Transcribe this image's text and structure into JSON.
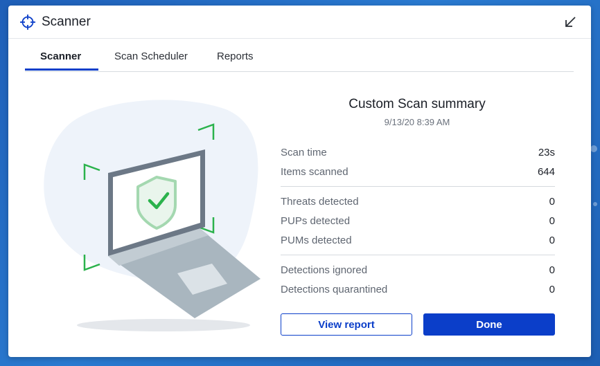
{
  "window": {
    "title": "Scanner"
  },
  "icons": {
    "app": "crosshair-icon",
    "minimize": "arrow-down-left-icon",
    "illustration": "laptop-shield-check-illustration"
  },
  "tabs": [
    {
      "label": "Scanner",
      "active": true
    },
    {
      "label": "Scan Scheduler",
      "active": false
    },
    {
      "label": "Reports",
      "active": false
    }
  ],
  "summary": {
    "title": "Custom Scan summary",
    "date": "9/13/20 8:39 AM",
    "rows": [
      {
        "label": "Scan time",
        "value": "23s"
      },
      {
        "label": "Items scanned",
        "value": "644"
      },
      {
        "label": "Threats detected",
        "value": "0"
      },
      {
        "label": "PUPs detected",
        "value": "0"
      },
      {
        "label": "PUMs detected",
        "value": "0"
      },
      {
        "label": "Detections ignored",
        "value": "0"
      },
      {
        "label": "Detections quarantined",
        "value": "0"
      }
    ]
  },
  "buttons": {
    "view_report": "View report",
    "done": "Done"
  },
  "colors": {
    "accent": "#0b3ec9",
    "success": "#2bb24c",
    "background": "#1f5fb8"
  }
}
